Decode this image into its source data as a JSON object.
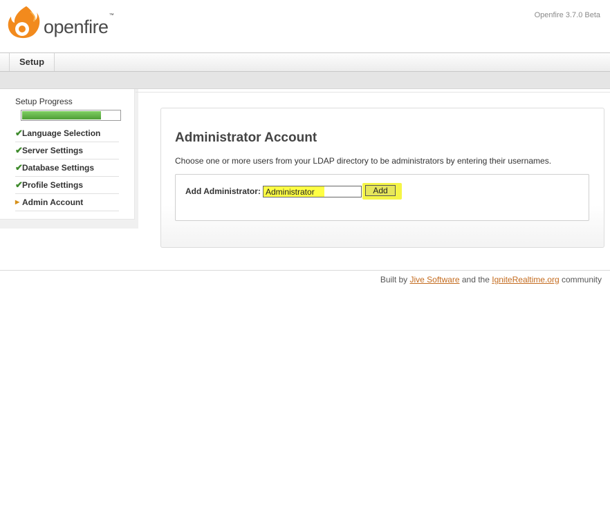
{
  "header": {
    "brand": "openfire",
    "trademark": "™",
    "version": "Openfire 3.7.0 Beta"
  },
  "nav": {
    "tabs": [
      {
        "label": "Setup",
        "active": true
      }
    ]
  },
  "sidebar": {
    "progress_title": "Setup Progress",
    "progress_fraction": 0.8,
    "steps": [
      {
        "label": "Language Selection",
        "status": "complete",
        "icon": "check-icon"
      },
      {
        "label": "Server Settings",
        "status": "complete",
        "icon": "check-icon"
      },
      {
        "label": "Database Settings",
        "status": "complete",
        "icon": "check-icon"
      },
      {
        "label": "Profile Settings",
        "status": "complete",
        "icon": "check-icon"
      },
      {
        "label": "Admin Account",
        "status": "current",
        "icon": "arrow-right-icon"
      }
    ]
  },
  "main": {
    "title": "Administrator Account",
    "description": "Choose one or more users from your LDAP directory to be administrators by entering their usernames.",
    "form": {
      "label": "Add Administrator:",
      "input_value": "Administrator",
      "add_label": "Add"
    }
  },
  "footer": {
    "prefix": "Built by ",
    "link1": "Jive Software",
    "middle": " and the ",
    "link2": "IgniteRealtime.org",
    "suffix": " community"
  },
  "colors": {
    "brand_orange": "#f28a1d",
    "link": "#c36a1d",
    "progress_green": "#5aa940",
    "check_green": "#3d8a2b",
    "highlight_yellow": "#ffff44"
  }
}
